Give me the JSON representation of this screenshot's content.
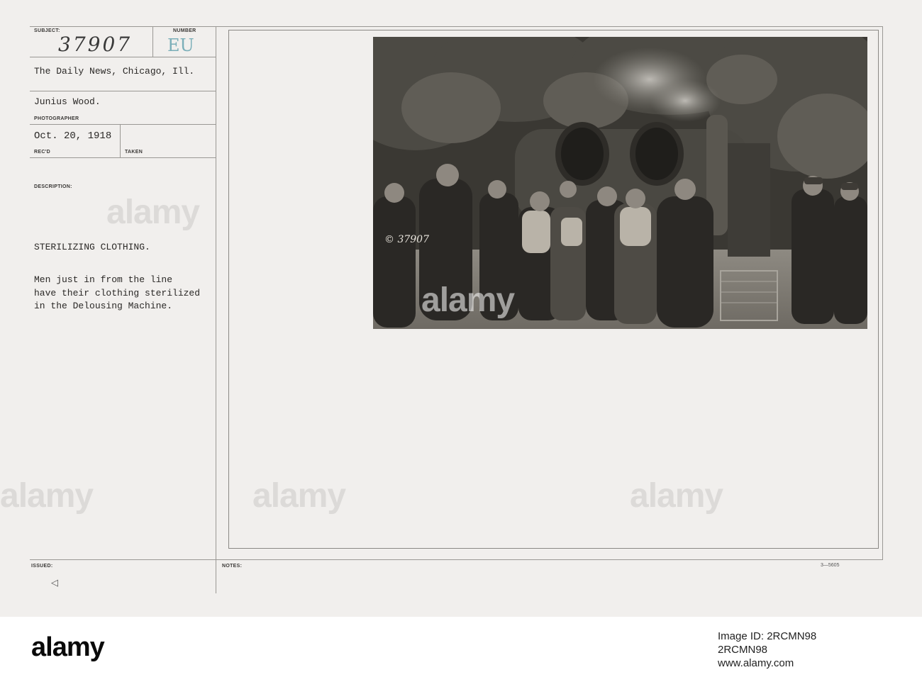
{
  "card": {
    "labels": {
      "subject": "SUBJECT:",
      "number": "NUMBER",
      "photographer": "PHOTOGRAPHER",
      "recd": "REC'D",
      "taken": "TAKEN",
      "description": "DESCRIPTION:",
      "issued": "ISSUED:",
      "notes": "NOTES:"
    },
    "subject_number": "37907",
    "number_stamp": "EU",
    "source": "The Daily News, Chicago, Ill.",
    "photographer_name": "Junius Wood.",
    "date_received": "Oct. 20, 1918",
    "title": "STERILIZING CLOTHING.",
    "description_lines": [
      "Men just in from the line",
      "have their clothing sterilized",
      "in the Delousing Machine."
    ],
    "photo_mark": "© 37907",
    "issued_mark": "◁",
    "form_code": "3—5605"
  },
  "watermark": {
    "text": "alamy"
  },
  "footer": {
    "logo": "alamy",
    "image_id": "Image ID: 2RCMN98",
    "alt_code": "2RCMN98",
    "url": "www.alamy.com"
  }
}
